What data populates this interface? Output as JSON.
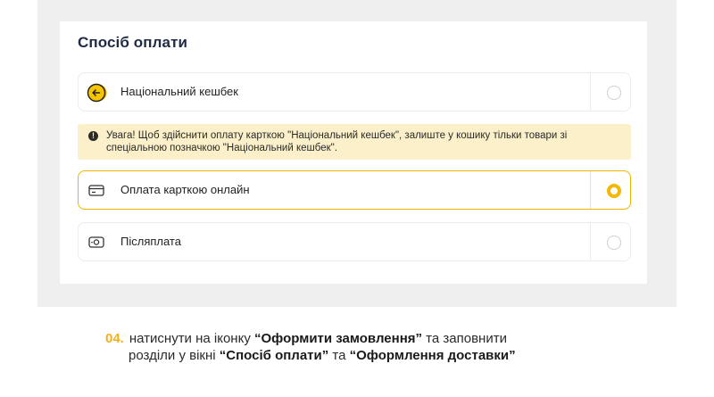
{
  "payment": {
    "title": "Спосіб оплати",
    "options": [
      {
        "label": "Національний кешбек",
        "icon": "cashback-coin-icon",
        "selected": false
      },
      {
        "label": "Оплата карткою онлайн",
        "icon": "credit-card-icon",
        "selected": true
      },
      {
        "label": "Післяплата",
        "icon": "cash-icon",
        "selected": false
      }
    ],
    "warning": "Увага! Щоб здійснити оплату карткою \"Національний кешбек\", залиште у кошику тільки товари зі спеціальною позначкою \"Національний кешбек\"."
  },
  "instruction": {
    "step": "04.",
    "part1": "натиснути на іконку ",
    "bold1": "“Оформити замовлення”",
    "part2": " та заповнити",
    "part3": "розділи у вікні ",
    "bold2": "“Спосіб оплати”",
    "part4": " та ",
    "bold3": "“Оформлення доставки”"
  },
  "colors": {
    "accent": "#f5b800",
    "warning_bg": "#fbf0c9",
    "title": "#1f2a44"
  }
}
